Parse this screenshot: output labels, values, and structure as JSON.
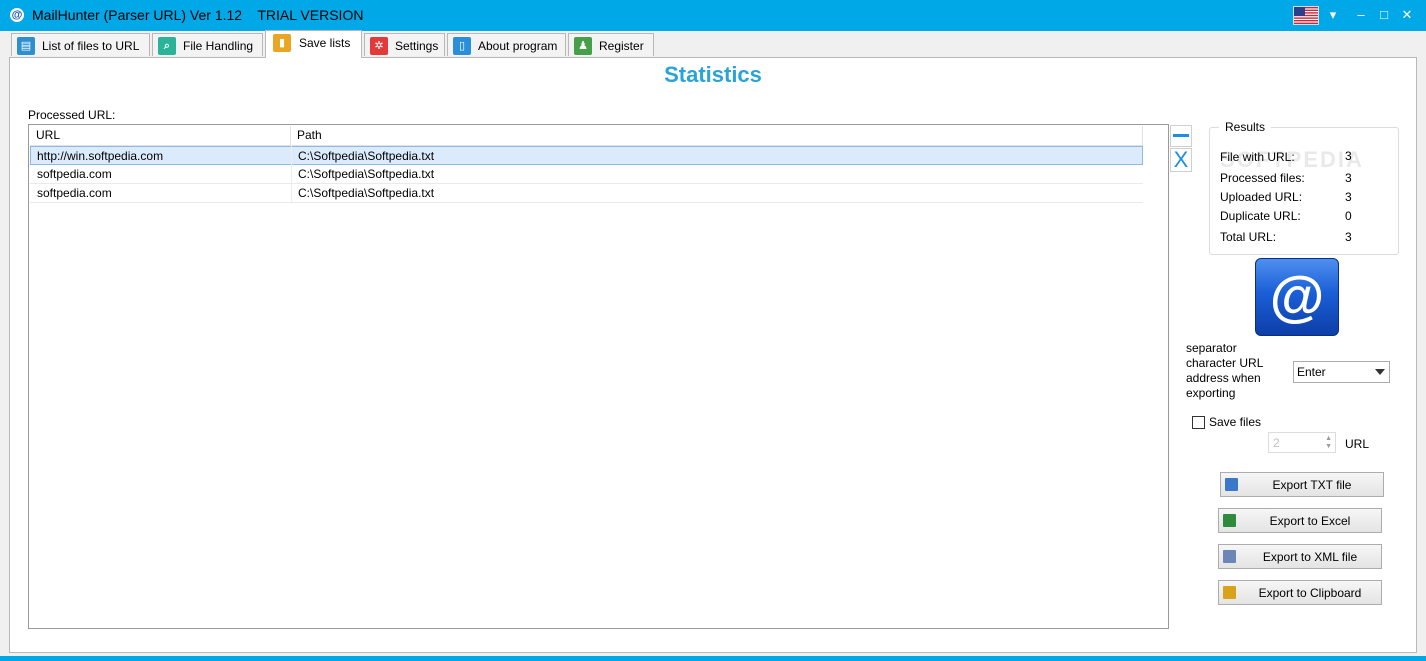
{
  "window": {
    "app_icon": "@",
    "title": "MailHunter (Parser URL) Ver 1.12    TRIAL VERSION",
    "flag_icon": "us-flag-icon",
    "colors": {
      "titlebar": "#00a8e8",
      "accent": "#2aa3d8"
    }
  },
  "tabs": [
    {
      "label": "List of files to URL",
      "icon": "file-list-icon",
      "icon_glyph": "▤",
      "color": "#2d8fd0"
    },
    {
      "label": "File Handling",
      "icon": "magnifier-icon",
      "icon_glyph": "⌕",
      "color": "#2bb39a"
    },
    {
      "label": "Save lists",
      "icon": "save-list-icon",
      "icon_glyph": "▮",
      "color": "#e9a623",
      "active": true
    },
    {
      "label": "Settings",
      "icon": "gear-icon",
      "icon_glyph": "✲",
      "color": "#e23a3a"
    },
    {
      "label": "About program",
      "icon": "document-icon",
      "icon_glyph": "▯",
      "color": "#2a8fd8"
    },
    {
      "label": "Register",
      "icon": "user-icon",
      "icon_glyph": "♟",
      "color": "#46a04a"
    }
  ],
  "main": {
    "heading": "Statistics",
    "processed_label": "Processed URL:",
    "columns": [
      "URL",
      "Path"
    ],
    "rows": [
      {
        "url": "http://win.softpedia.com",
        "path": "C:\\Softpedia\\Softpedia.txt",
        "selected": true
      },
      {
        "url": "softpedia.com",
        "path": "C:\\Softpedia\\Softpedia.txt"
      },
      {
        "url": "softpedia.com",
        "path": "C:\\Softpedia\\Softpedia.txt"
      }
    ],
    "remove_icon": "minus-icon",
    "clear_glyph": "X"
  },
  "results": {
    "title": "Results",
    "items": [
      {
        "label": "File with URL:",
        "value": "3"
      },
      {
        "label": "Processed files:",
        "value": "3"
      },
      {
        "label": "Uploaded URL:",
        "value": "3"
      },
      {
        "label": "Duplicate URL:",
        "value": "0"
      },
      {
        "label": "Total URL:",
        "value": "3"
      }
    ]
  },
  "logo_glyph": "@",
  "separator": {
    "label": "separator character URL address when exporting",
    "value": "Enter"
  },
  "save_files": {
    "label": "Save files",
    "checked": false
  },
  "spinner": {
    "value": "2",
    "unit_label": "URL"
  },
  "export_buttons": [
    {
      "label": "Export TXT file",
      "icon": "txt-file-icon",
      "color": "#3a78c9"
    },
    {
      "label": "Export to Excel",
      "icon": "excel-icon",
      "color": "#2e8b3c"
    },
    {
      "label": "Export to XML file",
      "icon": "xml-file-icon",
      "color": "#6c86b5"
    },
    {
      "label": "Export to Clipboard",
      "icon": "clipboard-icon",
      "color": "#d9a21b"
    }
  ],
  "watermark": "SOFTPEDIA"
}
